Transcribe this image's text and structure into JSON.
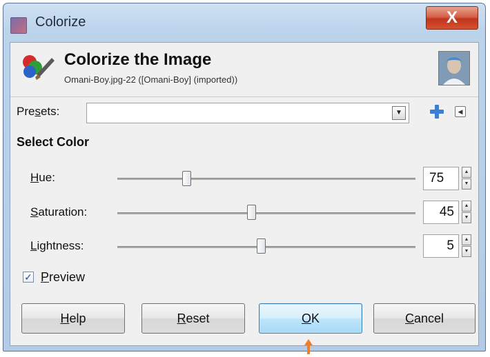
{
  "window": {
    "title": "Colorize",
    "close_label": "X"
  },
  "header": {
    "title": "Colorize the Image",
    "subtitle": "Omani-Boy.jpg-22 ([Omani-Boy] (imported))"
  },
  "presets": {
    "label_before": "Pre",
    "label_mnemonic": "s",
    "label_after": "ets:",
    "value": "",
    "add_icon": "plus-icon",
    "menu_icon": "triangle-left-icon"
  },
  "select_color": {
    "heading": "Select Color",
    "sliders": [
      {
        "label_mnemonic": "H",
        "label_rest": "ue:",
        "value": "75",
        "position": 0.22,
        "value_align": "left"
      },
      {
        "label_mnemonic": "S",
        "label_rest": "aturation:",
        "value": "45",
        "position": 0.44,
        "value_align": "right"
      },
      {
        "label_mnemonic": "L",
        "label_rest": "ightness:",
        "value": "5",
        "position": 0.47,
        "value_align": "right"
      }
    ]
  },
  "preview": {
    "label_mnemonic": "P",
    "label_rest": "review",
    "checked": true
  },
  "buttons": {
    "help": {
      "mnemonic": "H",
      "rest": "elp"
    },
    "reset": {
      "mnemonic": "R",
      "rest": "eset"
    },
    "ok": {
      "mnemonic": "O",
      "rest": "K"
    },
    "cancel": {
      "mnemonic": "C",
      "rest": "ancel"
    }
  },
  "colors": {
    "titlebar": "#b9d1ea",
    "close_button": "#c7402a",
    "default_button": "#bee6fd",
    "pointer_arrow": "#f07d2b"
  }
}
